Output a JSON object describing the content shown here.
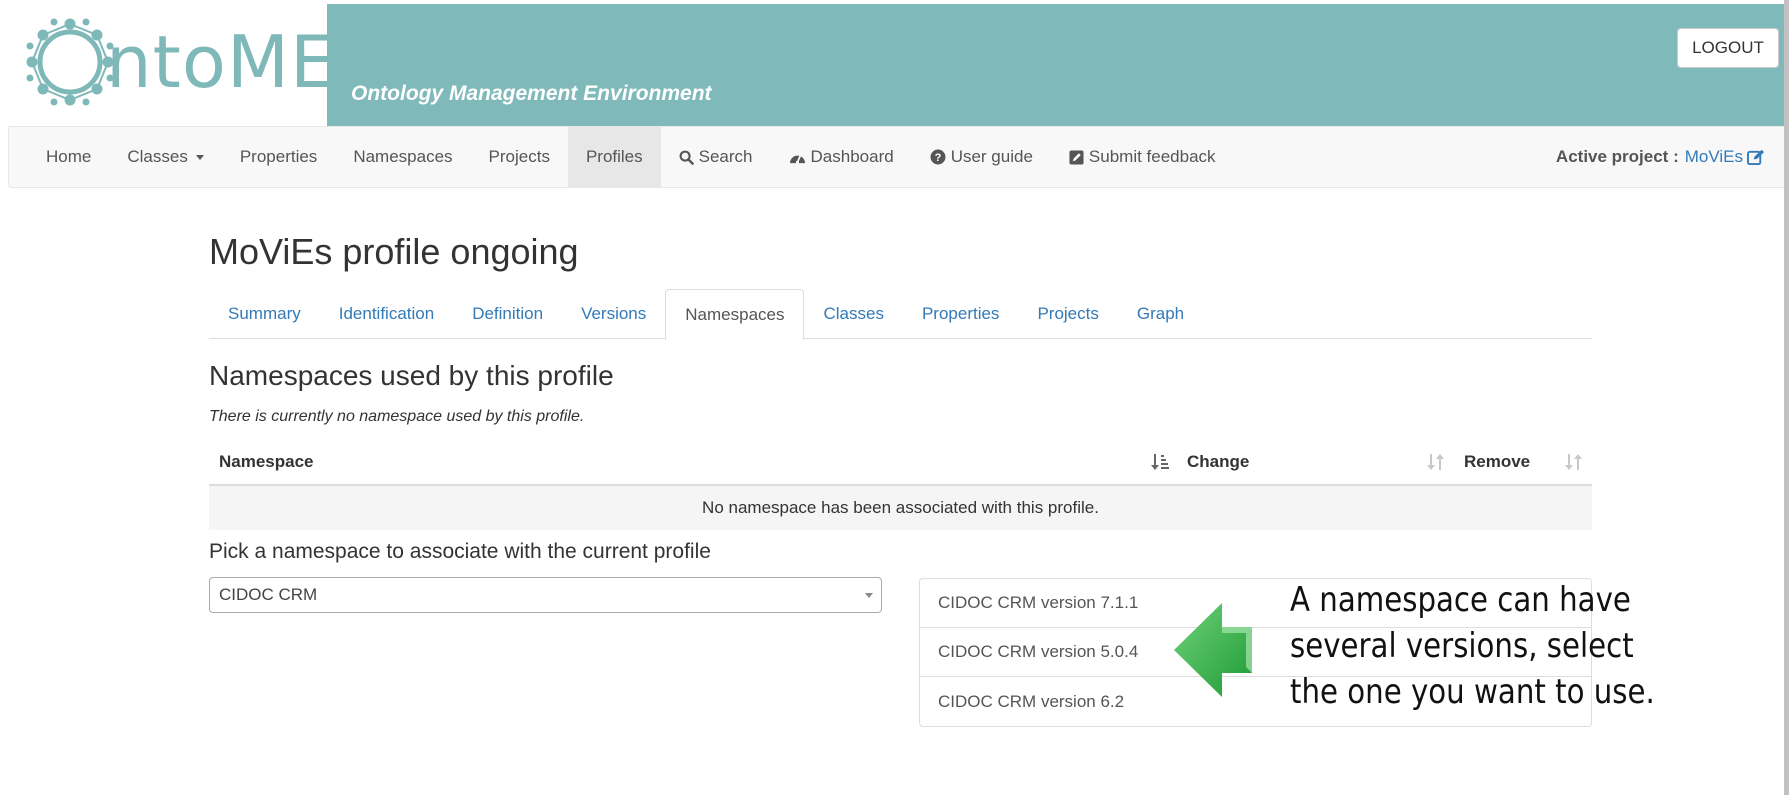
{
  "header": {
    "logo_text": "ntoME",
    "subtitle": "Ontology Management Environment",
    "logout_label": "LOGOUT"
  },
  "navbar": {
    "items": [
      {
        "label": "Home"
      },
      {
        "label": "Classes"
      },
      {
        "label": "Properties"
      },
      {
        "label": "Namespaces"
      },
      {
        "label": "Projects"
      },
      {
        "label": "Profiles"
      },
      {
        "label": "Search",
        "icon": "search-icon"
      },
      {
        "label": "Dashboard",
        "icon": "dashboard-icon"
      },
      {
        "label": "User guide",
        "icon": "question-circle-icon"
      },
      {
        "label": "Submit feedback",
        "icon": "edit-square-icon"
      }
    ],
    "active_item": "Profiles",
    "active_project_label": "Active project :",
    "active_project_value": "MoViEs"
  },
  "main": {
    "page_title": "MoViEs profile ongoing",
    "tabs": [
      {
        "label": "Summary"
      },
      {
        "label": "Identification"
      },
      {
        "label": "Definition"
      },
      {
        "label": "Versions"
      },
      {
        "label": "Namespaces"
      },
      {
        "label": "Classes"
      },
      {
        "label": "Properties"
      },
      {
        "label": "Projects"
      },
      {
        "label": "Graph"
      }
    ],
    "active_tab": "Namespaces",
    "section_title": "Namespaces used by this profile",
    "empty_note": "There is currently no namespace used by this profile.",
    "table": {
      "columns": [
        "Namespace",
        "Change",
        "Remove"
      ],
      "empty_row": "No namespace has been associated with this profile."
    },
    "pick_label": "Pick a namespace to associate with the current profile",
    "select_value": "CIDOC CRM",
    "versions": [
      "CIDOC CRM version 7.1.1",
      "CIDOC CRM version 5.0.4",
      "CIDOC CRM version 6.2"
    ]
  },
  "annotation": {
    "text": "A namespace can have several versions, select the one you want to use."
  },
  "colors": {
    "banner": "#80b9b9",
    "logo": "#7fb8b8",
    "link": "#337ab7",
    "arrow": "#3cb54a"
  }
}
